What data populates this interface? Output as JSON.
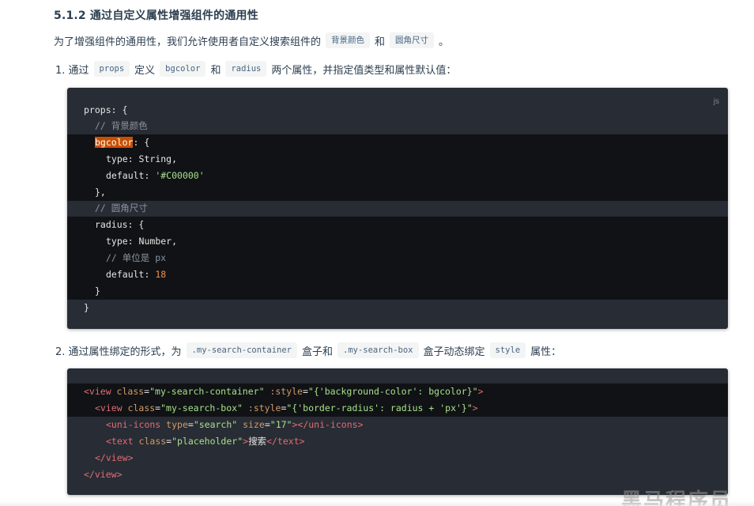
{
  "heading": "5.1.2 通过自定义属性增强组件的通用性",
  "intro": {
    "text": "为了增强组件的通用性，我们允许使用者自定义搜索组件的",
    "code1": "背景颜色",
    "and": "和",
    "code2": "圆角尺寸",
    "end": "。"
  },
  "step1": {
    "text1": "1. 通过",
    "code_props": "props",
    "text2": "定义",
    "code_bgcolor": "bgcolor",
    "text3": "和",
    "code_radius": "radius",
    "text4": "两个属性，并指定值类型和属性默认值："
  },
  "code_block_1": {
    "lang": "js",
    "lines": {
      "l1_key": "props",
      "l1_rest": ": {",
      "l2": "// 背景颜色",
      "l3_key": "bgcolor",
      "l3_rest": ": {",
      "l4_key": "type",
      "l4_rest": ": String,",
      "l5_key": "default",
      "l5_sep": ": ",
      "l5_val": "'#C00000'",
      "l6": "},",
      "l7": "// 圆角尺寸",
      "l8_key": "radius",
      "l8_rest": ": {",
      "l9_key": "type",
      "l9_rest": ": Number,",
      "l10": "// 单位是 px",
      "l11_key": "default",
      "l11_sep": ": ",
      "l11_val": "18",
      "l12": "}",
      "l13": "}"
    }
  },
  "step2": {
    "text1": "2. 通过属性绑定的形式，为",
    "code_container": ".my-search-container",
    "text2": "盒子和",
    "code_box": ".my-search-box",
    "text3": "盒子动态绑定",
    "code_style": "style",
    "text4": "属性："
  },
  "code_block_2": {
    "lines": {
      "l1_open": "<view",
      "l1_attr1": " class",
      "l1_eq1": "=",
      "l1_val1": "\"my-search-container\"",
      "l1_attr2": " :style",
      "l1_eq2": "=",
      "l1_val2": "\"{'background-color': bgcolor}\"",
      "l1_close": ">",
      "l2_open": "<view",
      "l2_attr1": " class",
      "l2_eq1": "=",
      "l2_val1": "\"my-search-box\"",
      "l2_attr2": " :style",
      "l2_eq2": "=",
      "l2_val2": "\"{'border-radius': radius + 'px'}\"",
      "l2_close": ">",
      "l3_open": "<uni-icons",
      "l3_attr1": " type",
      "l3_eq1": "=",
      "l3_val1": "\"search\"",
      "l3_attr2": " size",
      "l3_eq2": "=",
      "l3_val2": "\"17\"",
      "l3_mid": "></",
      "l3_tag": "uni-icons",
      "l3_close": ">",
      "l4_open": "<text",
      "l4_attr1": " class",
      "l4_eq1": "=",
      "l4_val1": "\"placeholder\"",
      "l4_gt": ">",
      "l4_text": "搜索",
      "l4_end_open": "</",
      "l4_end_tag": "text",
      "l4_end_close": ">",
      "l5_open": "</",
      "l5_tag": "view",
      "l5_close": ">",
      "l6_open": "</",
      "l6_tag": "view",
      "l6_close": ">"
    }
  },
  "watermark": "黑马程序员"
}
